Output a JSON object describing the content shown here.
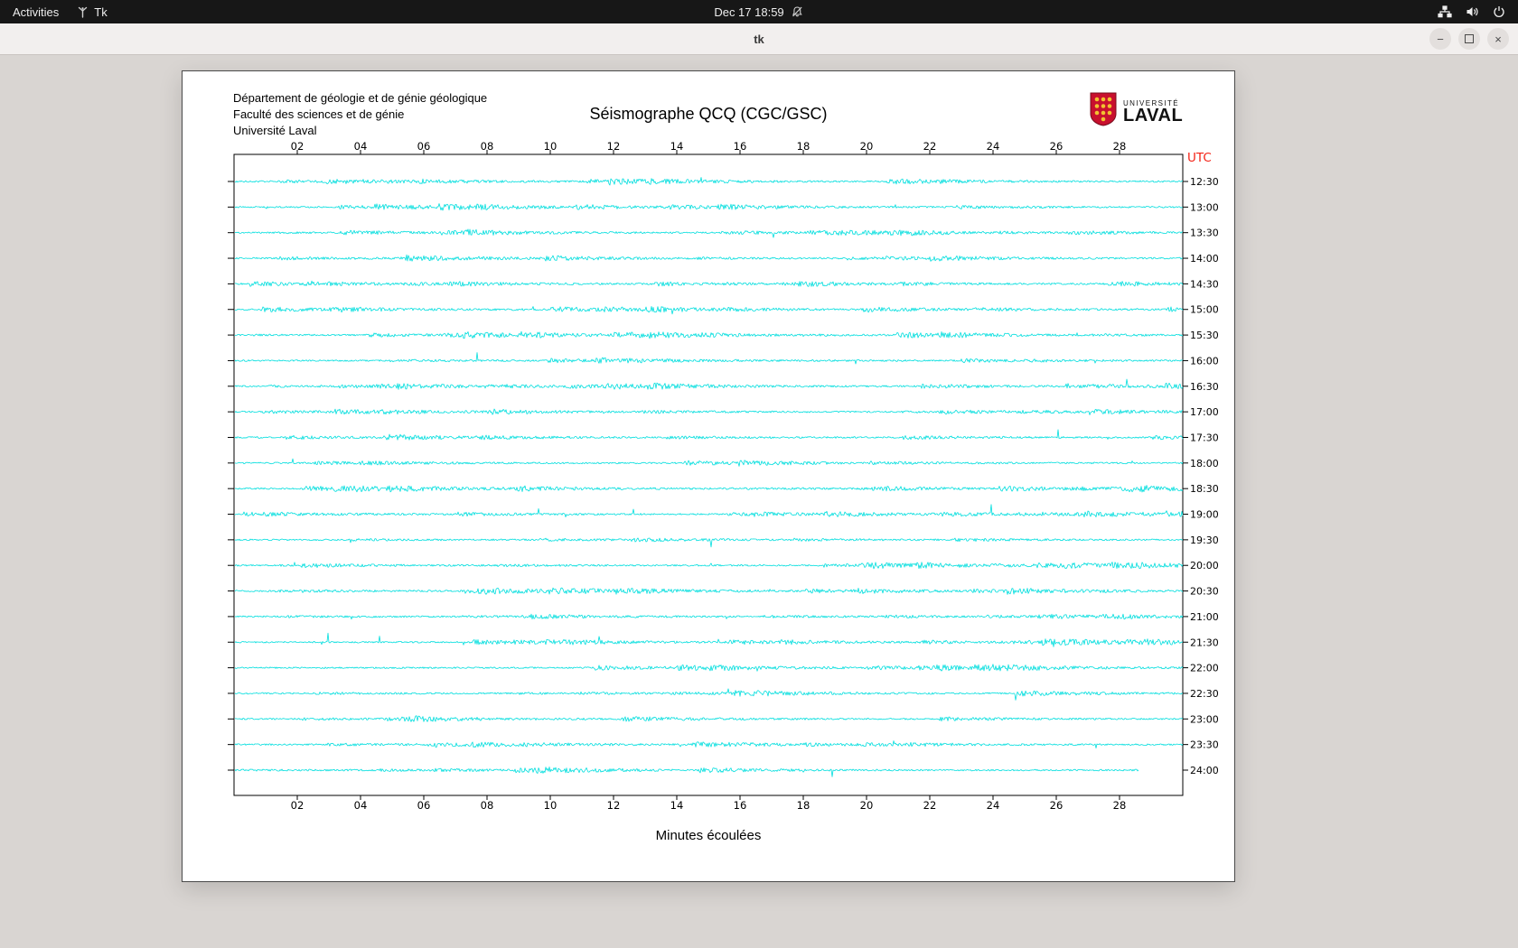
{
  "topbar": {
    "activities_label": "Activities",
    "app_label": "Tk",
    "clock_label": "Dec 17  18:59"
  },
  "titlebar": {
    "title": "tk"
  },
  "window": {
    "header_lines": [
      "Département de géologie et de génie géologique",
      "Faculté des sciences et de génie",
      "Université Laval"
    ],
    "title": "Séismographe QCQ (CGC/GSC)",
    "logo": {
      "line1": "UNIVERSITÉ",
      "line2": "LAVAL"
    }
  },
  "chart_data": {
    "type": "line",
    "title": "Séismographe QCQ (CGC/GSC)",
    "xlabel": "Minutes écoulées",
    "x_ticks": [
      "02",
      "04",
      "06",
      "08",
      "10",
      "12",
      "14",
      "16",
      "18",
      "20",
      "22",
      "24",
      "26",
      "28"
    ],
    "x_range_minutes": [
      0,
      30
    ],
    "utc_axis_label": "UTC",
    "trace_color": "#00dede",
    "utc_label_color": "#f32317",
    "axis_color": "#000000",
    "grid": false,
    "traces": [
      {
        "utc": "12:30"
      },
      {
        "utc": "13:00"
      },
      {
        "utc": "13:30"
      },
      {
        "utc": "14:00"
      },
      {
        "utc": "14:30"
      },
      {
        "utc": "15:00"
      },
      {
        "utc": "15:30"
      },
      {
        "utc": "16:00"
      },
      {
        "utc": "16:30"
      },
      {
        "utc": "17:00"
      },
      {
        "utc": "17:30"
      },
      {
        "utc": "18:00"
      },
      {
        "utc": "18:30"
      },
      {
        "utc": "19:00"
      },
      {
        "utc": "19:30"
      },
      {
        "utc": "20:00"
      },
      {
        "utc": "20:30"
      },
      {
        "utc": "21:00"
      },
      {
        "utc": "21:30"
      },
      {
        "utc": "22:00"
      },
      {
        "utc": "22:30"
      },
      {
        "utc": "23:00"
      },
      {
        "utc": "23:30"
      },
      {
        "utc": "24:00",
        "end_minute": 28.6
      }
    ]
  }
}
